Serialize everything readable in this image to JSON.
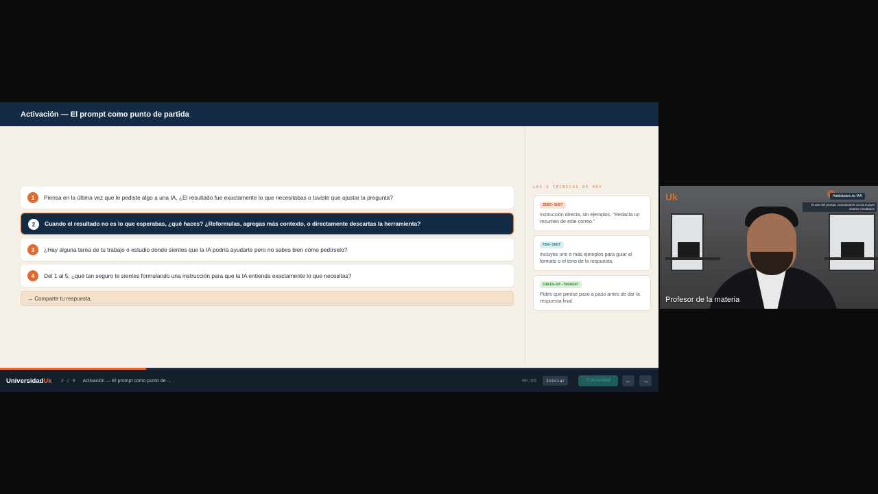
{
  "slide": {
    "title": "Activación — El prompt como punto de partida"
  },
  "questions": [
    {
      "num": "1",
      "text": "Piensa en la última vez que le pediste algo a una IA. ¿El resultado fue exactamente lo que necesitabas o tuviste que ajustar la pregunta?"
    },
    {
      "num": "2",
      "text": "Cuando el resultado no es lo que esperabas, ¿qué haces? ¿Reformulas, agregas más contexto, o directamente descartas la herramienta?"
    },
    {
      "num": "3",
      "text": "¿Hay alguna tarea de tu trabajo o estudio donde sientes que la IA podría ayudarte pero no sabes bien cómo pedírselo?"
    },
    {
      "num": "4",
      "text": "Del 1 al 5, ¿qué tan seguro te sientes formulando una instrucción para que la IA entienda exactamente lo que necesitas?"
    }
  ],
  "share_prompt": "→ Comparte tu respuesta.",
  "techniques": {
    "heading": "LAS 3 TÉCNICAS DE HOY",
    "items": [
      {
        "tag": "ZERO-SHOT",
        "desc": "Instrucción directa, sin ejemplos. \"Redacta un resumen de este correo.\""
      },
      {
        "tag": "FEW-SHOT",
        "desc": "Incluyes uno o más ejemplos para guiar el formato o el tono de la respuesta."
      },
      {
        "tag": "CHAIN-OF-THOUGHT",
        "desc": "Pides que piense paso a paso antes de dar la respuesta final."
      }
    ]
  },
  "footer": {
    "brand_main": "Universidad",
    "brand_accent": "Uk",
    "page_current": "2",
    "page_sep": "/",
    "page_total": "9",
    "slide_title": "Activación — El prompt como punto de ...",
    "timer": "00:00",
    "start_label": "Iniciar",
    "activity_label": "⏱ Actividad",
    "prev_label": "←",
    "next_label": "→",
    "progress": 0.222
  },
  "video": {
    "logo": "Uk",
    "badge": "Habilidades de IAA",
    "subtitle": "El arte del prompt: comunicarse con la IA para obtener resultados",
    "participant_name": "Profesor de la materia"
  },
  "colors": {
    "accent": "#e06a30",
    "navy": "#132b45",
    "slide_bg": "#f4efe7"
  }
}
